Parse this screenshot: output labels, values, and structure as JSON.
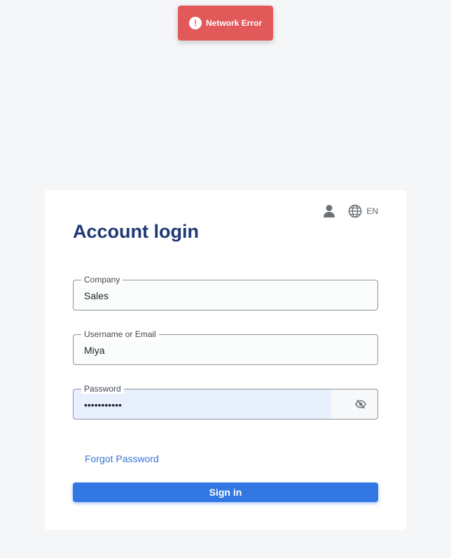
{
  "toast": {
    "message": "Network Error",
    "icon": "alert-circle-icon",
    "icon_glyph": "!",
    "color": "#e2595a"
  },
  "card": {
    "title": "Account login",
    "tools": {
      "user_icon": "user-icon",
      "language_icon": "globe-icon",
      "language": "EN"
    },
    "fields": {
      "company": {
        "label": "Company",
        "value": "Sales"
      },
      "username": {
        "label": "Username or Email",
        "value": "Miya"
      },
      "password": {
        "label": "Password",
        "value": "•••••••••••",
        "toggle_icon": "eye-off-icon"
      }
    },
    "forgot_label": "Forgot Password",
    "signin_label": "Sign in"
  },
  "colors": {
    "primary": "#3277e2",
    "title": "#1d3a73",
    "error": "#e2595a",
    "background": "#f5f6f8"
  }
}
